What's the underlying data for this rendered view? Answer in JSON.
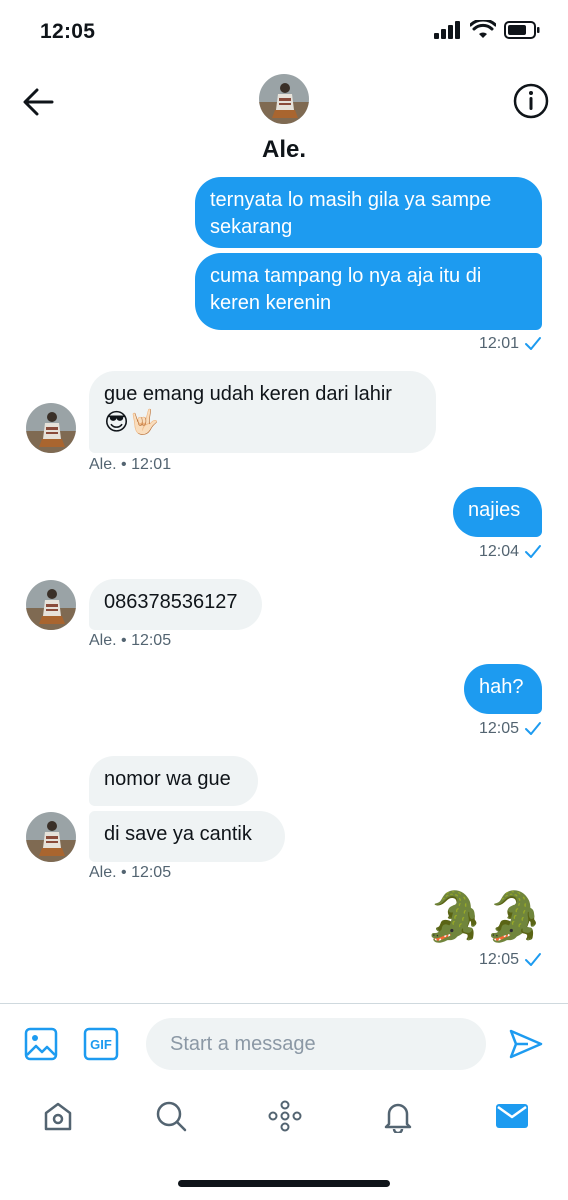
{
  "status_bar": {
    "time": "12:05"
  },
  "header": {
    "name": "Ale."
  },
  "messages": [
    {
      "id": "m1",
      "direction": "outgoing",
      "lines": [
        "ternyata lo masih gila ya sampe",
        "sekarang"
      ]
    },
    {
      "id": "m2",
      "direction": "outgoing",
      "lines": [
        "cuma tampang lo nya aja itu di",
        "keren kerenin"
      ],
      "time": "12:01"
    },
    {
      "id": "m3",
      "direction": "incoming",
      "lines": [
        "gue emang udah keren dari lahir"
      ],
      "emoji": "😎🤟🏻",
      "meta": "Ale. • 12:01"
    },
    {
      "id": "m4",
      "direction": "outgoing",
      "lines": [
        "najies"
      ],
      "time": "12:04"
    },
    {
      "id": "m5",
      "direction": "incoming",
      "lines": [
        "086378536127"
      ],
      "meta": "Ale. • 12:05"
    },
    {
      "id": "m6",
      "direction": "outgoing",
      "lines": [
        "hah?"
      ],
      "time": "12:05"
    },
    {
      "id": "m7",
      "direction": "incoming",
      "lines": [
        "nomor wa gue"
      ]
    },
    {
      "id": "m8",
      "direction": "incoming",
      "lines": [
        "di save ya cantik"
      ],
      "meta": "Ale. • 12:05"
    },
    {
      "id": "m9",
      "direction": "outgoing",
      "emoji": "🐊🐊",
      "time": "12:05"
    }
  ],
  "composer": {
    "placeholder": "Start a message",
    "gif_label": "GIF"
  },
  "tabs": [
    "home",
    "search",
    "spaces",
    "notifications",
    "messages"
  ],
  "active_tab": "messages",
  "colors": {
    "accent": "#1d9bf0",
    "incoming_bubble": "#eff3f4",
    "meta_text": "#536471",
    "placeholder": "#8b98a5"
  }
}
